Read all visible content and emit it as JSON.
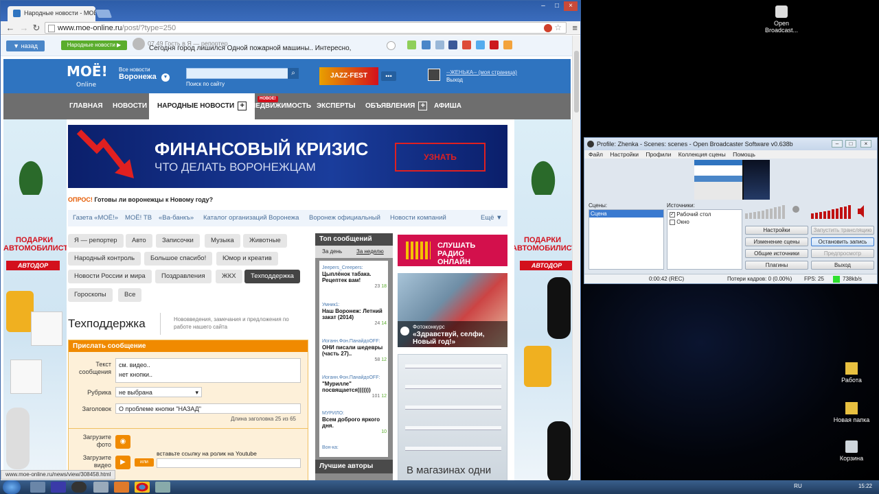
{
  "browser": {
    "tab_title": "Народные новости - МОЁ",
    "url_host": "www.moe-online.ru",
    "url_path": "/post/?type=250",
    "status_url": "www.moe-online.ru/news/view/308458.html"
  },
  "site": {
    "back_label": "назад",
    "folk_news_button": "Народные новости ▶",
    "ticker_meta": "07.49  Гость в Я — репортер",
    "ticker_text": "Сегодня город лишился Одной пожарной машины.. Интересно,",
    "logo_text": "МОЁ!",
    "logo_sub": "Online",
    "city_caption": "Все новости",
    "city_name": "Воронежа",
    "search_hint": "Поиск по сайту",
    "jazz_label": "JAZZ-FEST",
    "user_name": "--ЖЕНЬКА-- (моя страница)",
    "user_logout": "Выход",
    "nav": [
      {
        "label": "ГЛАВНАЯ"
      },
      {
        "label": "НОВОСТИ"
      },
      {
        "label": "НАРОДНЫЕ НОВОСТИ"
      },
      {
        "label": "НЕДВИЖИМОСТЬ",
        "badge": "НОВОЕ!"
      },
      {
        "label": "ЭКСПЕРТЫ"
      },
      {
        "label": "ОБЪЯВЛЕНИЯ"
      },
      {
        "label": "АФИША"
      }
    ],
    "banner": {
      "title": "ФИНАНСОВЫЙ КРИЗИС",
      "subtitle": "ЧТО ДЕЛАТЬ ВОРОНЕЖЦАМ",
      "button": "УЗНАТЬ"
    },
    "side_ad": {
      "gift": "ПОДАРКИ АВТОМОБИЛИСТАМ",
      "brand": "АВТОДОР"
    },
    "poll_label": "ОПРОС!",
    "poll_text": "Готовы ли воронежцы к Новому году?",
    "subnav": [
      "Газета «МОЁ!»",
      "МОЁ! ТВ",
      "«Ва-банкъ»",
      "Каталог организаций Воронежа",
      "Воронеж официальный",
      "Новости компаний",
      "Ещё ▼"
    ],
    "tags": [
      "Я — репортер",
      "Авто",
      "Записочки",
      "Музыка",
      "Животные",
      "Народный контроль",
      "Большое спасибо!",
      "Юмор и креатив",
      "Новости России и мира",
      "Поздравления",
      "ЖКХ",
      "Техподдержка",
      "Гороскопы",
      "Все"
    ],
    "page_title": "Техподдержка",
    "page_desc": "Нововведения, замечания и предложения по работе нашего сайта",
    "form": {
      "header": "Прислать сообщение",
      "text_label": "Текст сообщения",
      "text_line1": "см. видео..",
      "text_line2": "нет кнопки..",
      "rubric_label": "Рубрика",
      "rubric_value": "не выбрана",
      "title_label": "Заголовок",
      "title_value": "О проблеме кнопки \"НАЗАД\"",
      "title_counter": "Длина заголовка 25 из 65",
      "photo_label": "Загрузите фото",
      "video_label": "Загрузите видео",
      "or_label": "или",
      "video_hint": "вставьте ссылку на ролик на Youtube"
    },
    "top_messages": {
      "header": "Топ сообщений",
      "tab_day": "За день",
      "tab_week": "За неделю",
      "items": [
        {
          "author": "Jeepers_Creepers:",
          "text": "Цыплёнок табака. Рецептек вам!",
          "comments": "23",
          "likes": "18"
        },
        {
          "author": "Умник1:",
          "text": "Наш Воронеж: Летний закат (2014)",
          "comments": "24",
          "likes": "14"
        },
        {
          "author": "Иоганн.Фон.ПанайдоOFF:",
          "text": "ОНИ писали шедевры (часть 27)..",
          "comments": "58",
          "likes": "12"
        },
        {
          "author": "Иоганн.Фон.ПанайдоOFF:",
          "text": "\"Мурилле\" посвящается)))))))",
          "comments": "101",
          "likes": "12"
        },
        {
          "author": "МУРИЛО:",
          "text": "Всем доброго яркого дня.",
          "comments": "",
          "likes": "10"
        },
        {
          "author": "Вон-ка:",
          "text": "",
          "comments": "",
          "likes": ""
        }
      ],
      "best_authors": "Лучшие авторы"
    },
    "radio": "СЛУШАТЬ РАДИО ОНЛАЙН",
    "photo_caption_head": "Фотоконкурс",
    "photo_caption": "«Здравствуй, селфи, Новый год!»",
    "store_text": "В магазинах одни"
  },
  "obs": {
    "title": "Profile: Zhenka - Scenes: scenes - Open Broadcaster Software v0.638b",
    "menu": [
      "Файл",
      "Настройки",
      "Профили",
      "Коллекция сцены",
      "Помощь"
    ],
    "scenes_label": "Сцены:",
    "scene_item": "Сцена",
    "sources_label": "Источники:",
    "sources": [
      "Рабочий стол",
      "Окно"
    ],
    "buttons_left": [
      "Настройки",
      "Изменение сцены",
      "Общие источники",
      "Плагины"
    ],
    "buttons_right": [
      "Запустить трансляцию",
      "Остановить запись",
      "Предпросмотр",
      "Выход"
    ],
    "time": "0:00:42 (REC)",
    "dropped": "Потери кадров: 0 (0.00%)",
    "fps": "FPS: 25",
    "bitrate": "738kb/s"
  },
  "desktop": {
    "icons": [
      "Open Broadcast...",
      "Работа",
      "Новая папка",
      "Корзина"
    ],
    "clock": "15:22",
    "lang": "RU"
  }
}
